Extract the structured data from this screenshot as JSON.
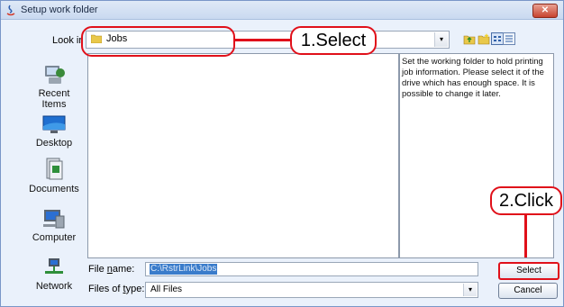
{
  "window": {
    "title": "Setup work folder",
    "close_label": "✕"
  },
  "lookin": {
    "label": "Look in:",
    "label_visible": "Look ir",
    "value": "Jobs",
    "dropdown_glyph": "▾"
  },
  "toolbar": {
    "icons": [
      "up-folder-icon",
      "new-folder-icon",
      "list-view-icon",
      "details-view-icon"
    ]
  },
  "sidebar": {
    "items": [
      {
        "label": "Recent Items",
        "icon": "recent-items-icon"
      },
      {
        "label": "Desktop",
        "icon": "desktop-icon"
      },
      {
        "label": "Documents",
        "icon": "documents-icon"
      },
      {
        "label": "Computer",
        "icon": "computer-icon"
      },
      {
        "label": "Network",
        "icon": "network-icon"
      }
    ]
  },
  "info_panel": {
    "text": "Set the working folder to hold printing job information. Please select it of the drive which has enough space. It is possible to change it later."
  },
  "file_name": {
    "label_pre": "File ",
    "label_key": "n",
    "label_post": "ame:",
    "value": "C:\\RstrLink\\Jobs"
  },
  "file_type": {
    "label_pre": "Files of ",
    "label_key": "t",
    "label_post": "ype:",
    "value": "All Files",
    "dropdown_glyph": "▾"
  },
  "buttons": {
    "select": "Select",
    "cancel": "Cancel"
  },
  "annotations": {
    "step1": "1.Select",
    "step2": "2.Click"
  },
  "colors": {
    "annotation_red": "#e0101a",
    "selection_blue": "#3a7ccb",
    "window_bg": "#eaf1fb"
  }
}
